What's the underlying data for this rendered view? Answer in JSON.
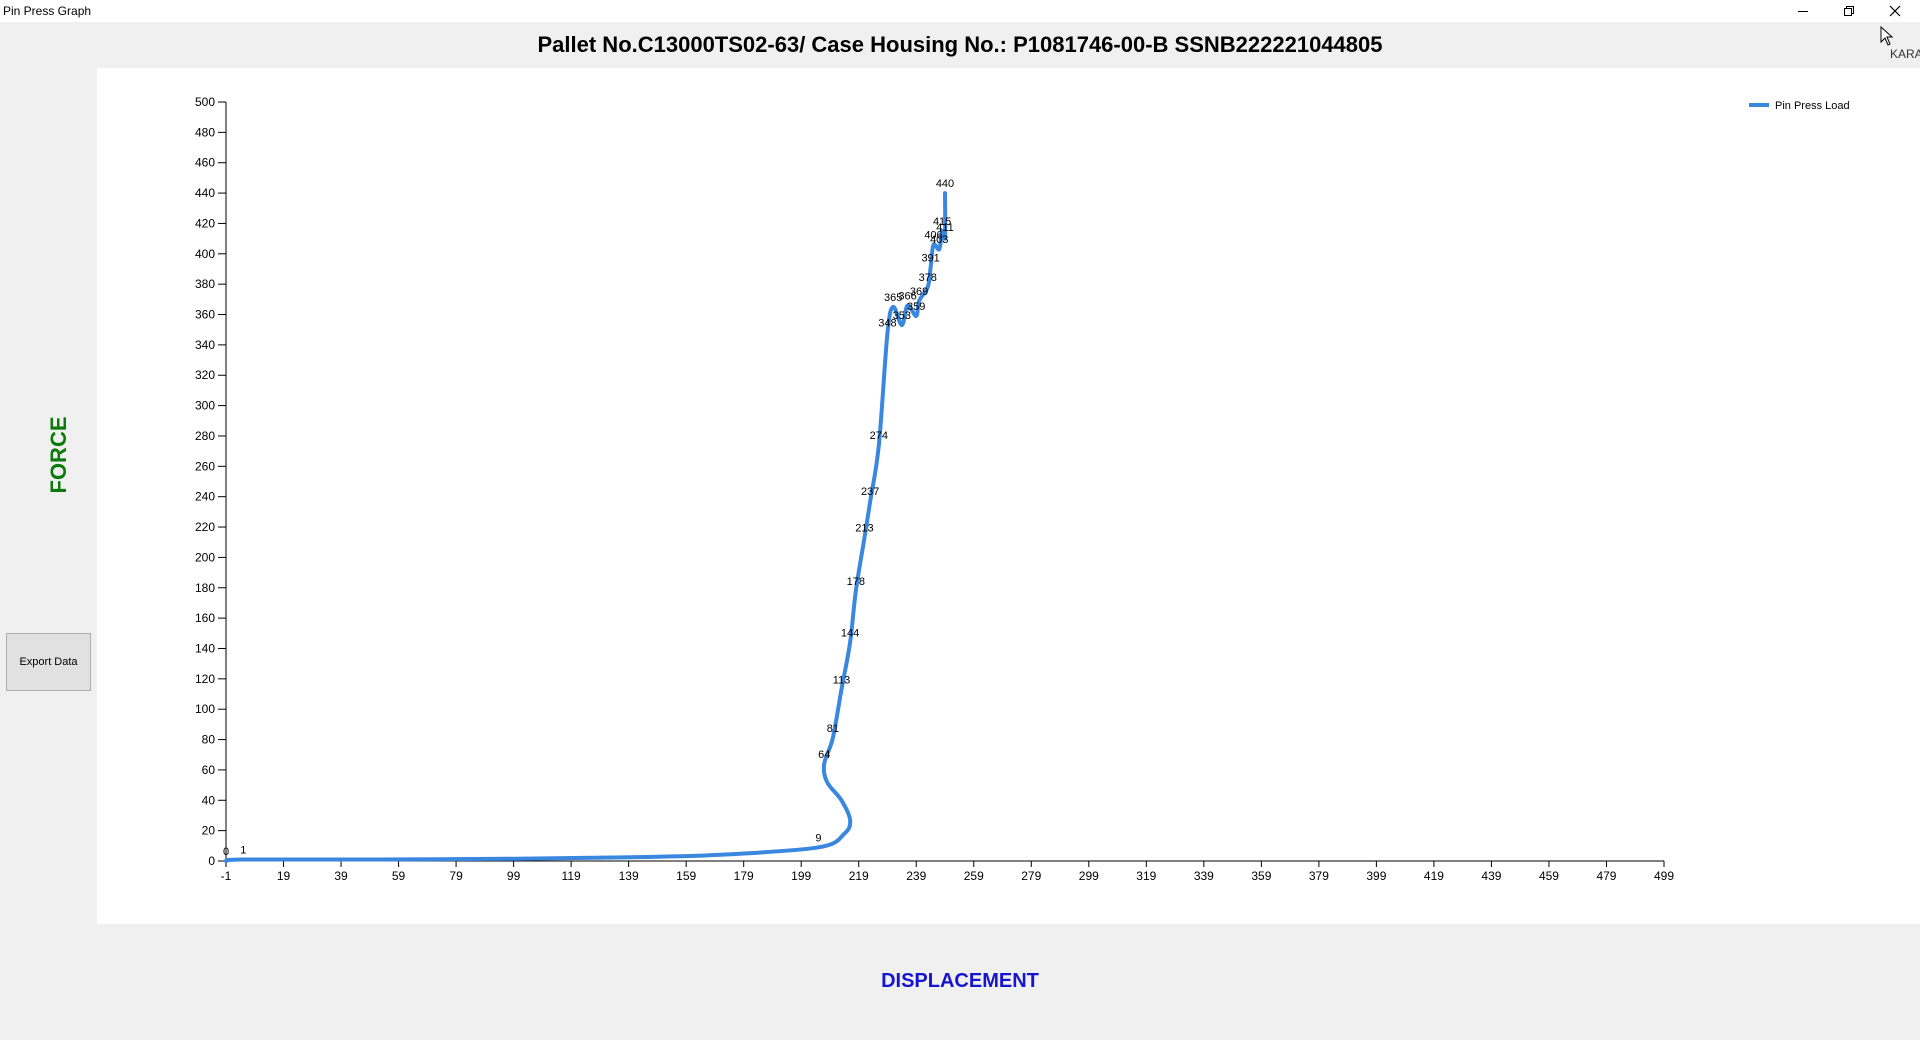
{
  "window": {
    "title": "Pin Press Graph",
    "user_tag": "KARA"
  },
  "header": {
    "title": "Pallet No.C13000TS02-63/ Case Housing No.: P1081746-00-B SSNB222221044805"
  },
  "axes": {
    "y_title": "FORCE",
    "x_title": "DISPLACEMENT",
    "y_title_color": "#0a7a0a",
    "x_title_color": "#1515d0"
  },
  "buttons": {
    "export_label": "Export Data"
  },
  "chart_data": {
    "type": "line",
    "title": "",
    "xlabel": "DISPLACEMENT",
    "ylabel": "FORCE",
    "xlim": [
      -1,
      499
    ],
    "ylim": [
      0,
      500
    ],
    "x_ticks": [
      -1,
      19,
      39,
      59,
      79,
      99,
      119,
      139,
      159,
      179,
      199,
      219,
      239,
      259,
      279,
      299,
      319,
      339,
      359,
      379,
      399,
      419,
      439,
      459,
      479,
      499
    ],
    "y_ticks": [
      0,
      20,
      40,
      60,
      80,
      100,
      120,
      140,
      160,
      180,
      200,
      220,
      240,
      260,
      280,
      300,
      320,
      340,
      360,
      380,
      400,
      420,
      440,
      460,
      480,
      500
    ],
    "grid": false,
    "legend_position": "top-right",
    "series": [
      {
        "name": "Pin Press Load",
        "color": "#3a87e0",
        "points": [
          {
            "x": -1,
            "y": 0,
            "label": "0"
          },
          {
            "x": 5,
            "y": 1,
            "label": "1"
          },
          {
            "x": 50,
            "y": 1
          },
          {
            "x": 100,
            "y": 1.5
          },
          {
            "x": 140,
            "y": 2.5
          },
          {
            "x": 170,
            "y": 4
          },
          {
            "x": 205,
            "y": 9,
            "label": "9"
          },
          {
            "x": 214,
            "y": 18
          },
          {
            "x": 216,
            "y": 27
          },
          {
            "x": 213,
            "y": 40
          },
          {
            "x": 208,
            "y": 52
          },
          {
            "x": 207,
            "y": 64,
            "label": "64"
          },
          {
            "x": 210,
            "y": 81,
            "label": "81"
          },
          {
            "x": 213,
            "y": 113,
            "label": "113"
          },
          {
            "x": 216,
            "y": 144,
            "label": "144"
          },
          {
            "x": 218,
            "y": 178,
            "label": "178"
          },
          {
            "x": 221,
            "y": 213,
            "label": "213"
          },
          {
            "x": 223,
            "y": 237,
            "label": "237"
          },
          {
            "x": 226,
            "y": 274,
            "label": "274"
          },
          {
            "x": 229,
            "y": 348,
            "label": "348"
          },
          {
            "x": 231,
            "y": 365,
            "label": "365"
          },
          {
            "x": 234,
            "y": 353,
            "label": "353"
          },
          {
            "x": 236,
            "y": 366,
            "label": "366"
          },
          {
            "x": 239,
            "y": 359,
            "label": "359"
          },
          {
            "x": 240,
            "y": 369,
            "label": "369"
          },
          {
            "x": 243,
            "y": 378,
            "label": "378"
          },
          {
            "x": 244,
            "y": 391,
            "label": "391"
          },
          {
            "x": 245,
            "y": 406,
            "label": "406"
          },
          {
            "x": 247,
            "y": 403,
            "label": "403"
          },
          {
            "x": 248,
            "y": 415,
            "label": "415"
          },
          {
            "x": 249,
            "y": 411,
            "label": "411"
          },
          {
            "x": 249,
            "y": 440,
            "label": "440"
          }
        ]
      }
    ]
  }
}
